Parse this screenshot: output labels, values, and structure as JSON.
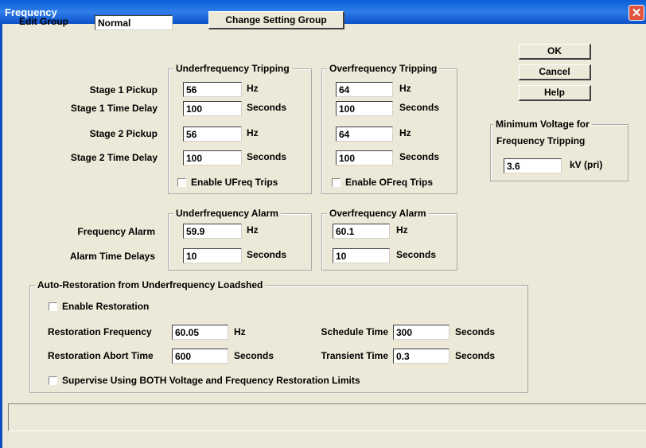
{
  "window": {
    "title": "Frequency",
    "close_glyph": "✕"
  },
  "edit_group": {
    "label": "Edit Group",
    "value": "Normal"
  },
  "buttons": {
    "change_setting_group": "Change Setting Group",
    "ok": "OK",
    "cancel": "Cancel",
    "help": "Help"
  },
  "row_labels": {
    "stage1_pickup": "Stage 1 Pickup",
    "stage1_delay": "Stage 1 Time Delay",
    "stage2_pickup": "Stage 2 Pickup",
    "stage2_delay": "Stage 2 Time Delay",
    "freq_alarm": "Frequency Alarm",
    "alarm_delays": "Alarm Time Delays"
  },
  "units": {
    "hz": "Hz",
    "seconds": "Seconds",
    "kv": "kV (pri)"
  },
  "underfreq_tripping": {
    "title": "Underfrequency Tripping",
    "stage1_pickup": "56",
    "stage1_delay": "100",
    "stage2_pickup": "56",
    "stage2_delay": "100",
    "enable_label": "Enable UFreq Trips"
  },
  "overfreq_tripping": {
    "title": "Overfrequency Tripping",
    "stage1_pickup": "64",
    "stage1_delay": "100",
    "stage2_pickup": "64",
    "stage2_delay": "100",
    "enable_label": "Enable OFreq Trips"
  },
  "min_voltage": {
    "title_line1": "Minimum Voltage for",
    "title_line2": "Frequency Tripping",
    "value": "3.6"
  },
  "underfreq_alarm": {
    "title": "Underfrequency Alarm",
    "freq": "59.9",
    "delay": "10"
  },
  "overfreq_alarm": {
    "title": "Overfrequency Alarm",
    "freq": "60.1",
    "delay": "10"
  },
  "restoration": {
    "title": "Auto-Restoration from Underfrequency Loadshed",
    "enable_label": "Enable Restoration",
    "freq_label": "Restoration Frequency",
    "freq_value": "60.05",
    "abort_label": "Restoration Abort Time",
    "abort_value": "600",
    "schedule_label": "Schedule Time",
    "schedule_value": "300",
    "transient_label": "Transient Time",
    "transient_value": "0.3",
    "supervise_label": "Supervise Using BOTH Voltage and Frequency Restoration Limits"
  }
}
